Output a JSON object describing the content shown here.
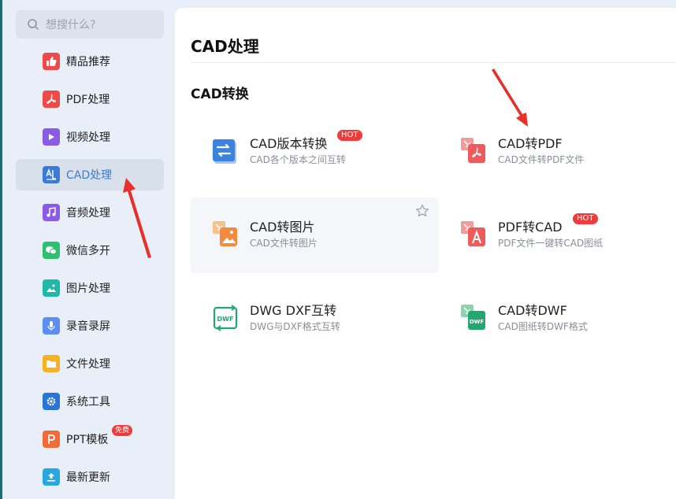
{
  "sidebar": {
    "search_placeholder": "想搜什么?",
    "items": [
      {
        "label": "精品推荐",
        "color": "#ef4a4a",
        "icon": "thumbs-up-icon",
        "active": false
      },
      {
        "label": "PDF处理",
        "color": "#ef4a4a",
        "icon": "pdf-icon",
        "active": false
      },
      {
        "label": "视频处理",
        "color": "#8a5ce6",
        "icon": "play-icon",
        "active": false
      },
      {
        "label": "CAD处理",
        "color": "#3a7bd5",
        "icon": "cad-icon",
        "active": true
      },
      {
        "label": "音频处理",
        "color": "#8a5ce6",
        "icon": "music-icon",
        "active": false
      },
      {
        "label": "微信多开",
        "color": "#2fbf71",
        "icon": "wechat-icon",
        "active": false
      },
      {
        "label": "图片处理",
        "color": "#22b8a8",
        "icon": "image-icon",
        "active": false
      },
      {
        "label": "录音录屏",
        "color": "#5b8ef0",
        "icon": "microphone-icon",
        "active": false
      },
      {
        "label": "文件处理",
        "color": "#f5b323",
        "icon": "folder-icon",
        "active": false
      },
      {
        "label": "系统工具",
        "color": "#2a73d9",
        "icon": "gear-icon",
        "active": false
      },
      {
        "label": "PPT模板",
        "color": "#f06a3a",
        "icon": "ppt-icon",
        "active": false,
        "badge": "免费"
      },
      {
        "label": "最新更新",
        "color": "#29a7e0",
        "icon": "upload-icon",
        "active": false
      }
    ]
  },
  "main": {
    "title": "CAD处理",
    "section_title": "CAD转换",
    "tools": [
      {
        "title": "CAD版本转换",
        "desc": "CAD各个版本之间互转",
        "badge": "HOT",
        "icon": "swap-icon"
      },
      {
        "title": "CAD转PDF",
        "desc": "CAD文件转PDF文件",
        "badge": "",
        "icon": "cad-to-pdf-icon"
      },
      {
        "title": "CAD转图片",
        "desc": "CAD文件转图片",
        "badge": "",
        "icon": "cad-to-image-icon"
      },
      {
        "title": "PDF转CAD",
        "desc": "PDF文件一键转CAD图纸",
        "badge": "HOT",
        "icon": "pdf-to-cad-icon"
      },
      {
        "title": "DWG DXF互转",
        "desc": "DWG与DXF格式互转",
        "badge": "",
        "icon": "dwg-dxf-icon"
      },
      {
        "title": "CAD转DWF",
        "desc": "CAD图纸转DWF格式",
        "badge": "",
        "icon": "cad-to-dwf-icon"
      }
    ]
  },
  "colors": {
    "accent": "#3a7bd5",
    "hot_badge": "#ef3b3b",
    "annotation_arrow": "#e8302a"
  }
}
